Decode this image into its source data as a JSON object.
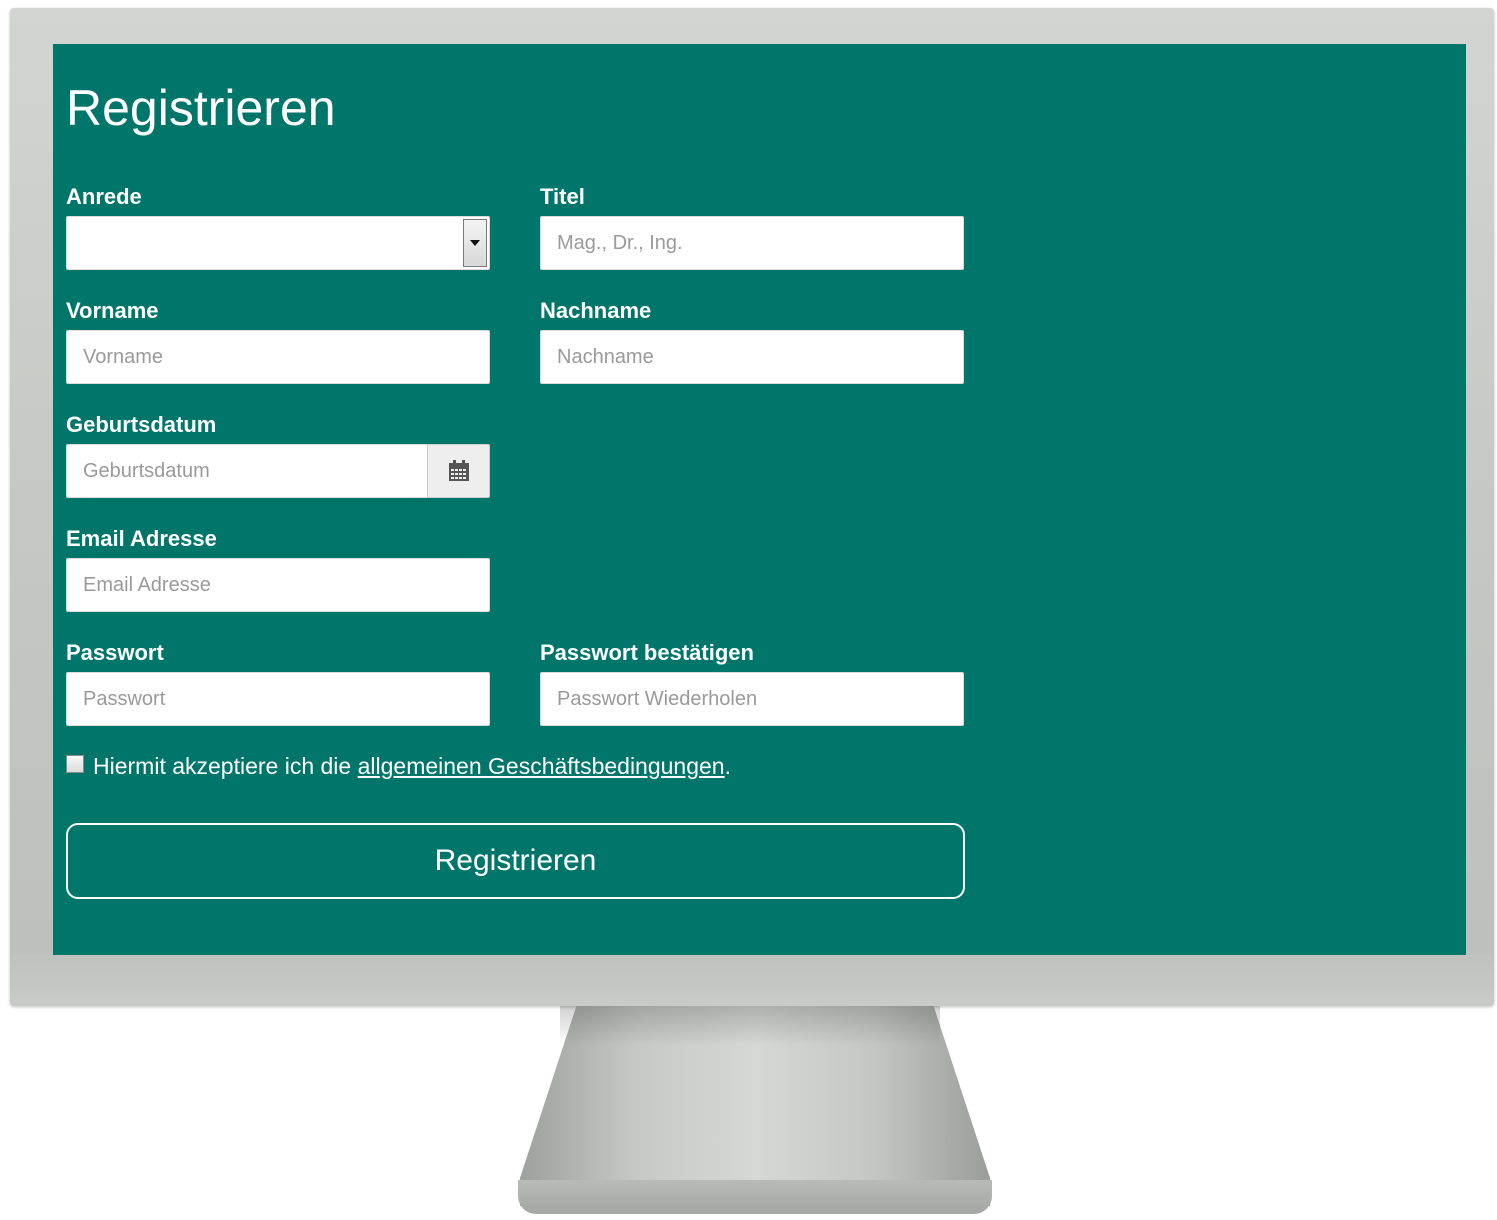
{
  "form": {
    "title": "Registrieren",
    "anrede": {
      "label": "Anrede",
      "value": ""
    },
    "titel": {
      "label": "Titel",
      "placeholder": "Mag., Dr., Ing."
    },
    "vorname": {
      "label": "Vorname",
      "placeholder": "Vorname"
    },
    "nachname": {
      "label": "Nachname",
      "placeholder": "Nachname"
    },
    "geburtsdatum": {
      "label": "Geburtsdatum",
      "placeholder": "Geburtsdatum",
      "icon": "calendar-icon"
    },
    "email": {
      "label": "Email Adresse",
      "placeholder": "Email Adresse"
    },
    "passwort": {
      "label": "Passwort",
      "placeholder": "Passwort"
    },
    "passwort_bestaetigen": {
      "label": "Passwort bestätigen",
      "placeholder": "Passwort Wiederholen"
    },
    "terms": {
      "checked": false,
      "prefix": "Hiermit akzeptiere ich die",
      "link_text": "allgemeinen Geschäftsbedingungen",
      "suffix": "."
    },
    "submit_label": "Registrieren"
  },
  "colors": {
    "screen_background": "#00766a",
    "text": "#ffffff",
    "input_background": "#ffffff",
    "placeholder": "#9a9a9a"
  }
}
